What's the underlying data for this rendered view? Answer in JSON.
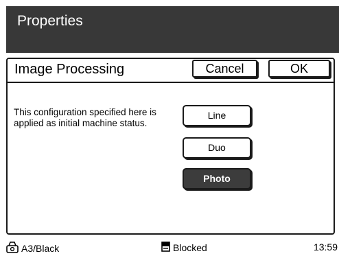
{
  "header": {
    "title": "Properties"
  },
  "panel": {
    "title": "Image Processing",
    "cancel_label": "Cancel",
    "ok_label": "OK",
    "description": "This configuration specified here is applied as initial machine status.",
    "options": [
      {
        "label": "Line",
        "selected": false
      },
      {
        "label": "Duo",
        "selected": false
      },
      {
        "label": "Photo",
        "selected": true
      }
    ]
  },
  "status": {
    "paper": "A3/Black",
    "state": "Blocked",
    "time": "13:59"
  },
  "colors": {
    "titlebar_bg": "#383838",
    "selected_bg": "#3c3c3c",
    "border": "#1a1a1a"
  },
  "icons": {
    "paper": "copier-icon",
    "state": "document-icon"
  }
}
